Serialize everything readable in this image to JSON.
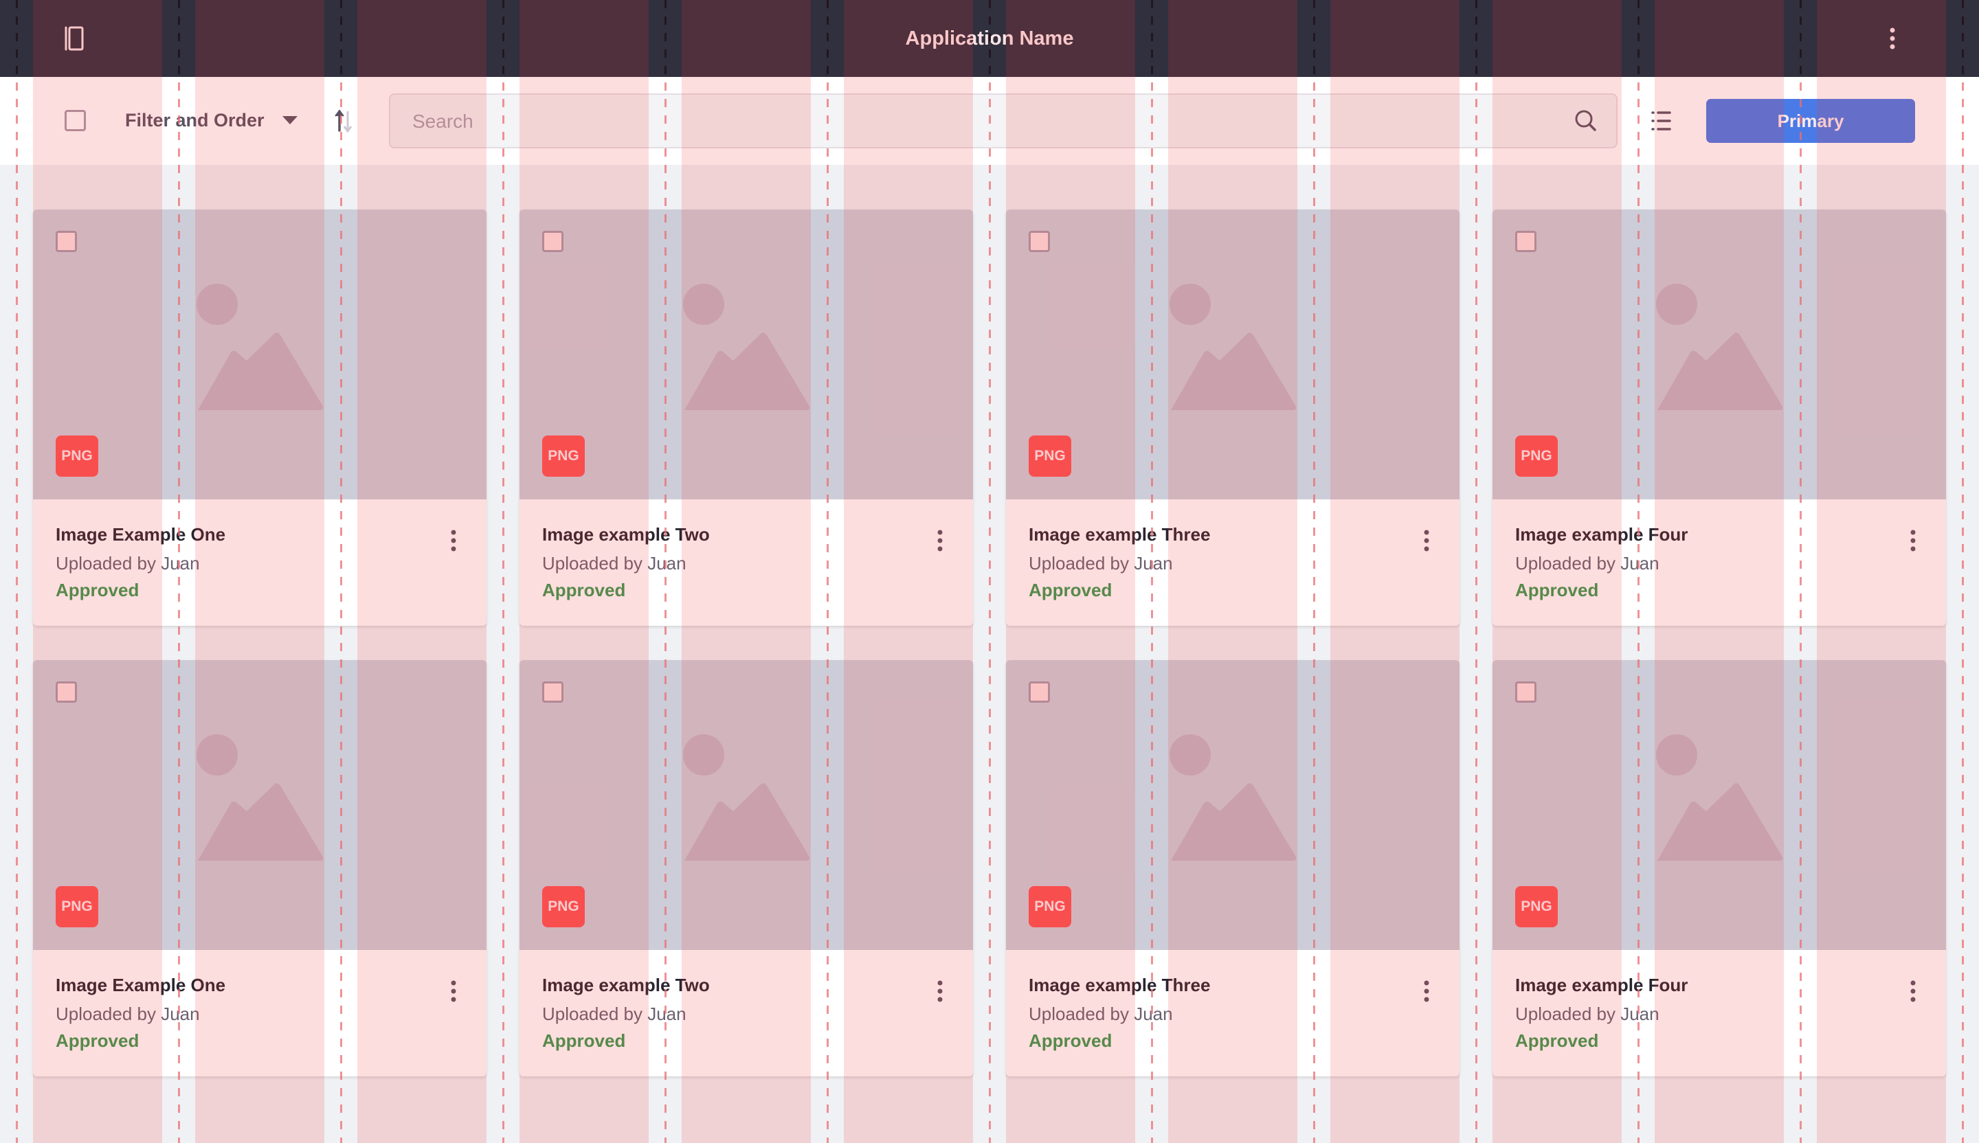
{
  "header": {
    "title": "Application Name",
    "left_icon": "sidebar-toggle-icon",
    "right_icon": "more-vertical-icon"
  },
  "toolbar": {
    "filter_label": "Filter and Order",
    "sort_icon": "sort-up-down-icon",
    "search_placeholder": "Search",
    "search_value": "",
    "view_icon": "list-view-icon",
    "primary_label": "Primary"
  },
  "colors": {
    "header_bg": "#30303e",
    "primary": "#4a7ae6",
    "badge": "#fb5454",
    "approved": "#3a9a50"
  },
  "cards": [
    {
      "title": "Image Example One",
      "subtitle": "Uploaded by Juan",
      "status": "Approved",
      "badge": "PNG"
    },
    {
      "title": "Image example Two",
      "subtitle": "Uploaded by Juan",
      "status": "Approved",
      "badge": "PNG"
    },
    {
      "title": "Image example Three",
      "subtitle": "Uploaded by Juan",
      "status": "Approved",
      "badge": "PNG"
    },
    {
      "title": "Image example Four",
      "subtitle": "Uploaded by Juan",
      "status": "Approved",
      "badge": "PNG"
    },
    {
      "title": "Image Example One",
      "subtitle": "Uploaded by Juan",
      "status": "Approved",
      "badge": "PNG"
    },
    {
      "title": "Image example Two",
      "subtitle": "Uploaded by Juan",
      "status": "Approved",
      "badge": "PNG"
    },
    {
      "title": "Image example Three",
      "subtitle": "Uploaded by Juan",
      "status": "Approved",
      "badge": "PNG"
    },
    {
      "title": "Image example Four",
      "subtitle": "Uploaded by Juan",
      "status": "Approved",
      "badge": "PNG"
    }
  ]
}
